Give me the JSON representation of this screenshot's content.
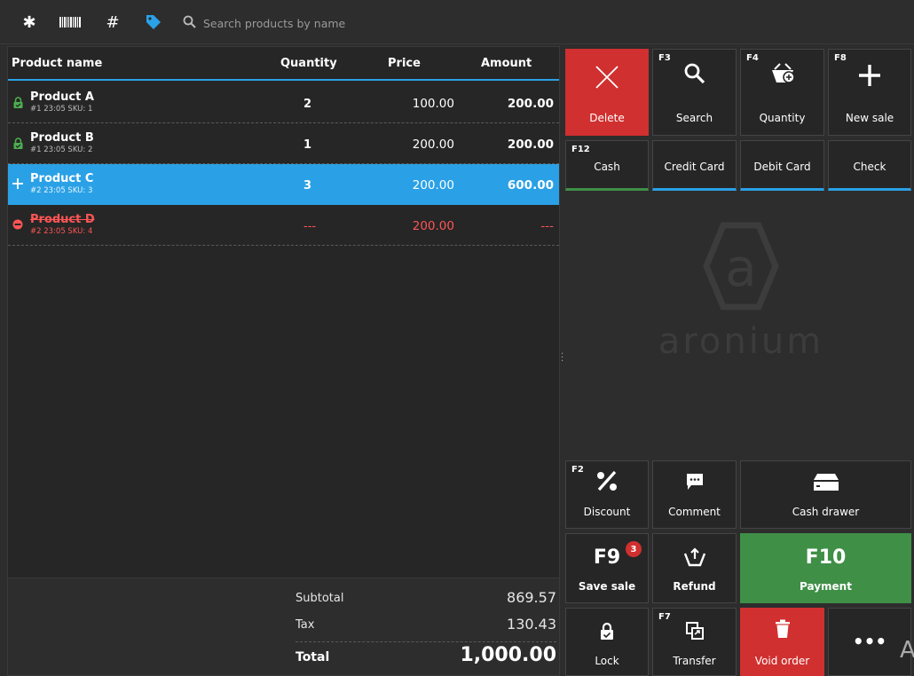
{
  "toolbar": {
    "icons": [
      "asterisk-icon",
      "barcode-icon",
      "hash-icon",
      "tag-icon",
      "search-icon"
    ],
    "search_placeholder": "Search products by name",
    "hash_glyph": "#",
    "asterisk_glyph": "✱"
  },
  "table": {
    "headers": {
      "name": "Product name",
      "quantity": "Quantity",
      "price": "Price",
      "amount": "Amount"
    },
    "rows": [
      {
        "name": "Product A",
        "meta": "#1 23:05 SKU: 1",
        "quantity": "2",
        "price": "100.00",
        "amount": "200.00",
        "status": "locked"
      },
      {
        "name": "Product B",
        "meta": "#1 23:05 SKU: 2",
        "quantity": "1",
        "price": "200.00",
        "amount": "200.00",
        "status": "locked"
      },
      {
        "name": "Product C",
        "meta": "#2 23:05 SKU: 3",
        "quantity": "3",
        "price": "200.00",
        "amount": "600.00",
        "status": "selected"
      },
      {
        "name": "Product D",
        "meta": "#2 23:05 SKU: 4",
        "quantity": "---",
        "price": "200.00",
        "amount": "---",
        "status": "voided"
      }
    ]
  },
  "summary": {
    "subtotal_label": "Subtotal",
    "subtotal": "869.57",
    "tax_label": "Tax",
    "tax": "130.43",
    "total_label": "Total",
    "total": "1,000.00"
  },
  "buttons": {
    "delete": {
      "label": "Delete"
    },
    "search": {
      "key": "F3",
      "label": "Search"
    },
    "quantity": {
      "key": "F4",
      "label": "Quantity"
    },
    "new_sale": {
      "key": "F8",
      "label": "New sale"
    },
    "cash": {
      "key": "F12",
      "label": "Cash"
    },
    "credit_card": {
      "label": "Credit Card"
    },
    "debit_card": {
      "label": "Debit Card"
    },
    "check": {
      "label": "Check"
    },
    "discount": {
      "key": "F2",
      "label": "Discount"
    },
    "comment": {
      "label": "Comment"
    },
    "cash_drawer": {
      "label": "Cash drawer"
    },
    "save_sale": {
      "key": "F9",
      "label": "Save sale",
      "badge": "3"
    },
    "refund": {
      "label": "Refund"
    },
    "payment": {
      "key": "F10",
      "label": "Payment"
    },
    "lock": {
      "label": "Lock"
    },
    "transfer": {
      "key": "F7",
      "label": "Transfer"
    },
    "void_order": {
      "label": "Void order"
    },
    "more": {
      "label": "•••"
    }
  },
  "logo": {
    "letter": "a",
    "text": "aronium"
  },
  "edge_letter": "A",
  "colors": {
    "accent": "#2aa1e6",
    "danger": "#d0302f",
    "success": "#3f8f47",
    "lock_green": "#4caf50",
    "void_red": "#ff5555"
  }
}
